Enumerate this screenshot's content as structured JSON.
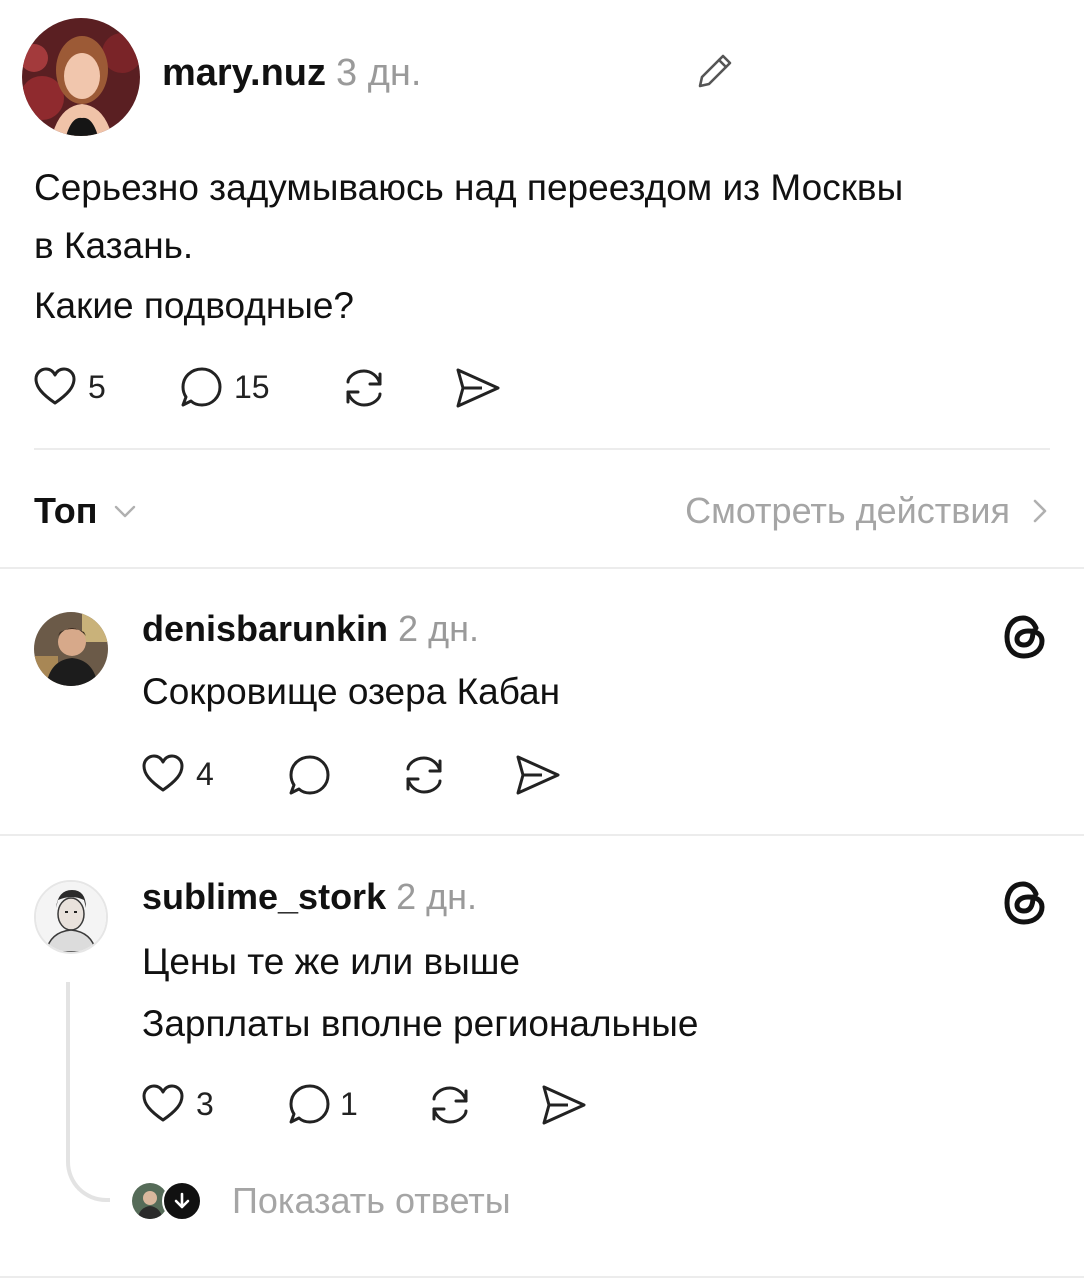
{
  "post": {
    "username": "mary.nuz",
    "time": "3 дн.",
    "text_line1": "Серьезно задумываюсь над переездом из Москвы",
    "text_line2": "в Казань.",
    "text_line3": "Какие подводные?",
    "likes": "5",
    "comments": "15",
    "icons": [
      "edit-pencil-icon",
      "heart-icon",
      "comment-icon",
      "repost-icon",
      "share-icon"
    ]
  },
  "filter": {
    "sort_label": "Топ",
    "view_activity": "Смотреть действия"
  },
  "replies": [
    {
      "username": "denisbarunkin",
      "time": "2 дн.",
      "line1": "Сокровище озера Кабан",
      "likes": "4",
      "comments": ""
    },
    {
      "username": "sublime_stork",
      "time": "2 дн.",
      "line1": "Цены те же или выше",
      "line2": "Зарплаты вполне региональные",
      "likes": "3",
      "comments": "1",
      "show_replies": "Показать ответы"
    }
  ],
  "colors": {
    "muted": "#9a9a9a",
    "divider": "#ececec",
    "text": "#111111"
  }
}
